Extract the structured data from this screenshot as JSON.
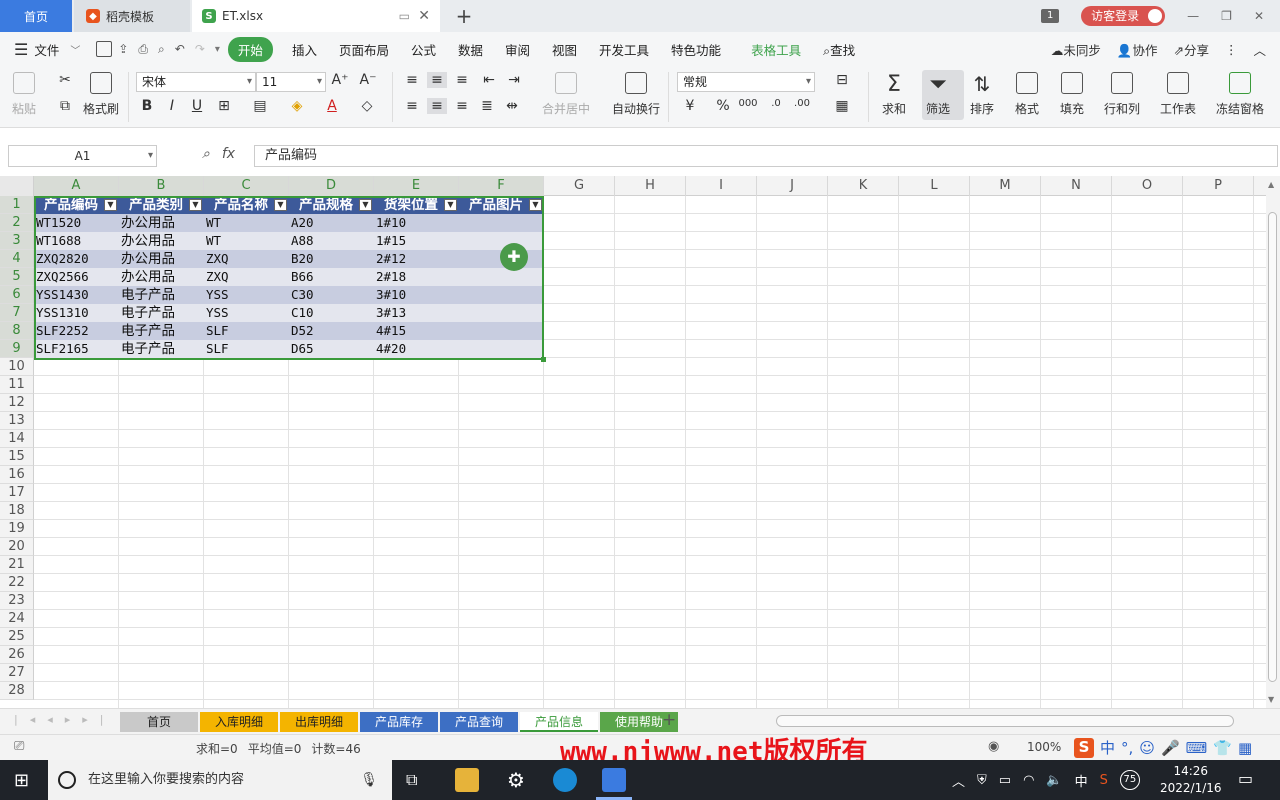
{
  "tabs": {
    "home": "首页",
    "template": "稻壳模板",
    "file": "ET.xlsx",
    "add": "+",
    "window_count": "1",
    "login": "访客登录"
  },
  "menu": {
    "file": "文件",
    "items": [
      "开始",
      "插入",
      "页面布局",
      "公式",
      "数据",
      "审阅",
      "视图",
      "开发工具",
      "特色功能"
    ],
    "table_tools": "表格工具",
    "search": "查找",
    "right": [
      "未同步",
      "协作",
      "分享"
    ]
  },
  "ribbon": {
    "paste": "粘贴",
    "format_painter": "格式刷",
    "font_name": "宋体",
    "font_size": "11",
    "merge": "合并居中",
    "wrap": "自动换行",
    "number_format": "常规",
    "sum": "求和",
    "filter": "筛选",
    "sort": "排序",
    "format": "格式",
    "fill": "填充",
    "rowcol": "行和列",
    "sheet": "工作表",
    "freeze": "冻结窗格"
  },
  "formula_bar": {
    "name_box": "A1",
    "fx": "fx",
    "formula": "产品编码"
  },
  "columns": [
    "A",
    "B",
    "C",
    "D",
    "E",
    "F",
    "G",
    "H",
    "I",
    "J",
    "K",
    "L",
    "M",
    "N",
    "O",
    "P"
  ],
  "rows": [
    "1",
    "2",
    "3",
    "4",
    "5",
    "6",
    "7",
    "8",
    "9",
    "10",
    "11",
    "12",
    "13",
    "14",
    "15",
    "16",
    "17",
    "18",
    "19",
    "20",
    "21",
    "22",
    "23",
    "24",
    "25",
    "26",
    "27",
    "28"
  ],
  "table": {
    "headers": [
      "产品编码",
      "产品类别",
      "产品名称",
      "产品规格",
      "货架位置",
      "产品图片"
    ],
    "data": [
      [
        "WT1520",
        "办公用品",
        "WT",
        "A20",
        "1#10",
        ""
      ],
      [
        "WT1688",
        "办公用品",
        "WT",
        "A88",
        "1#15",
        ""
      ],
      [
        "ZXQ2820",
        "办公用品",
        "ZXQ",
        "B20",
        "2#12",
        ""
      ],
      [
        "ZXQ2566",
        "办公用品",
        "ZXQ",
        "B66",
        "2#18",
        ""
      ],
      [
        "YSS1430",
        "电子产品",
        "YSS",
        "C30",
        "3#10",
        ""
      ],
      [
        "YSS1310",
        "电子产品",
        "YSS",
        "C10",
        "3#13",
        ""
      ],
      [
        "SLF2252",
        "电子产品",
        "SLF",
        "D52",
        "4#15",
        ""
      ],
      [
        "SLF2165",
        "电子产品",
        "SLF",
        "D65",
        "4#20",
        ""
      ]
    ]
  },
  "sheets": [
    {
      "name": "首页",
      "color": "#c9c9c9",
      "text": "#222"
    },
    {
      "name": "入库明细",
      "color": "#f4b400",
      "text": "#222"
    },
    {
      "name": "出库明细",
      "color": "#f4b400",
      "text": "#222"
    },
    {
      "name": "产品库存",
      "color": "#3d6fc4",
      "text": "#fff"
    },
    {
      "name": "产品查询",
      "color": "#3d6fc4",
      "text": "#fff"
    },
    {
      "name": "产品信息",
      "color": "#ffffff",
      "text": "#3a9a3a"
    },
    {
      "name": "使用帮助",
      "color": "#5aa64a",
      "text": "#fff"
    }
  ],
  "status": {
    "sum": "求和=0",
    "avg": "平均值=0",
    "count": "计数=46",
    "watermark": "www.njwww.net版权所有",
    "zoom": "100%"
  },
  "taskbar": {
    "search_placeholder": "在这里输入你要搜索的内容",
    "time": "14:26",
    "date": "2022/1/16",
    "ime": "中",
    "battery": "75"
  }
}
